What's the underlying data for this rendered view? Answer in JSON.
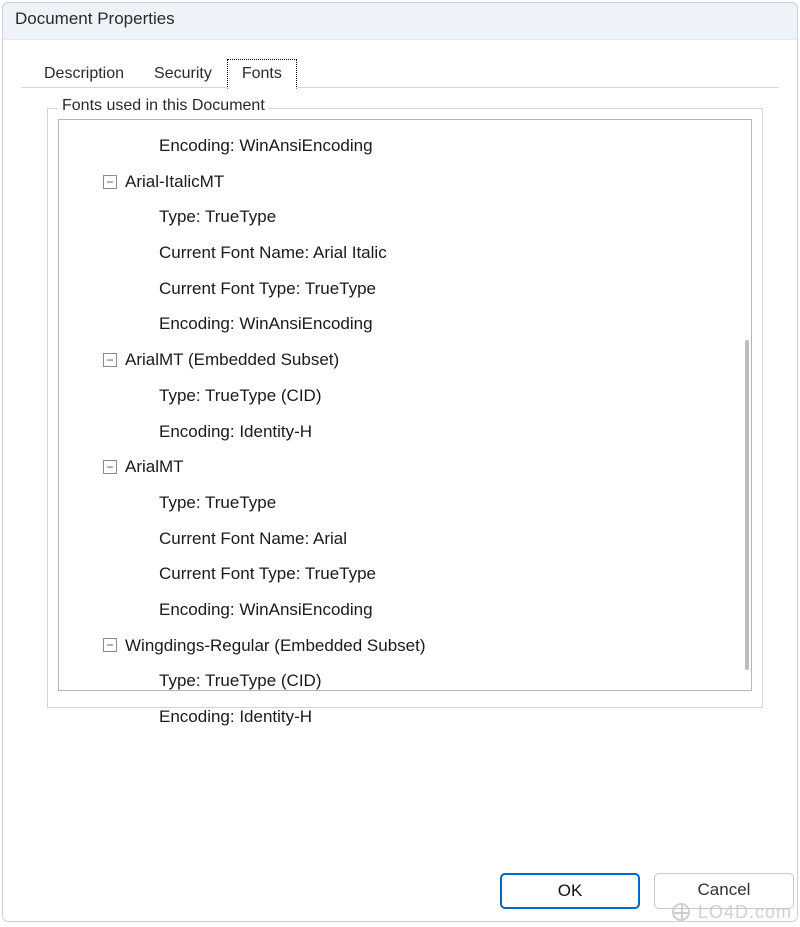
{
  "window": {
    "title": "Document Properties"
  },
  "tabs": [
    {
      "label": "Description",
      "active": false
    },
    {
      "label": "Security",
      "active": false
    },
    {
      "label": "Fonts",
      "active": true
    }
  ],
  "group": {
    "legend": "Fonts used in this Document"
  },
  "tree": {
    "orphan_first": "Encoding: WinAnsiEncoding",
    "nodes": [
      {
        "label": "Arial-ItalicMT",
        "children": [
          "Type: TrueType",
          "Current Font Name: Arial Italic",
          "Current Font Type: TrueType",
          "Encoding: WinAnsiEncoding"
        ]
      },
      {
        "label": "ArialMT (Embedded Subset)",
        "children": [
          "Type: TrueType (CID)",
          "Encoding: Identity-H"
        ]
      },
      {
        "label": "ArialMT",
        "children": [
          "Type: TrueType",
          "Current Font Name: Arial",
          "Current Font Type: TrueType",
          "Encoding: WinAnsiEncoding"
        ]
      },
      {
        "label": "Wingdings-Regular (Embedded Subset)",
        "children": [
          "Type: TrueType (CID)",
          "Encoding: Identity-H"
        ]
      }
    ]
  },
  "buttons": {
    "ok": "OK",
    "cancel": "Cancel"
  },
  "watermark": "LO4D.com"
}
